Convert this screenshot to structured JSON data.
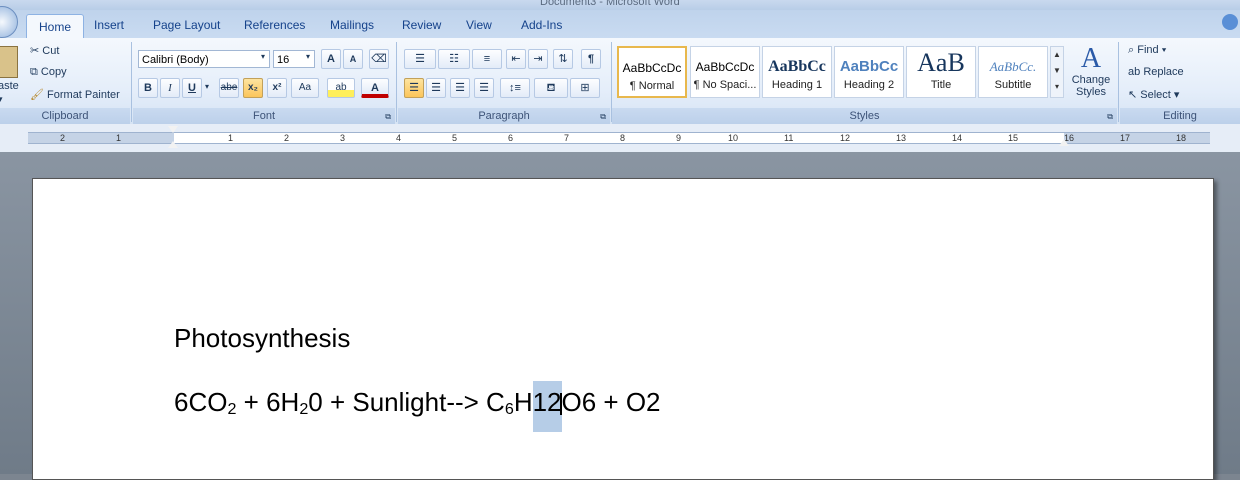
{
  "window": {
    "title": "Document3 - Microsoft Word"
  },
  "tabs": [
    "Home",
    "Insert",
    "Page Layout",
    "References",
    "Mailings",
    "Review",
    "View",
    "Add-Ins"
  ],
  "clipboard": {
    "paste": "aste",
    "cut": "Cut",
    "copy": "Copy",
    "format_painter": "Format Painter",
    "label": "Clipboard"
  },
  "font": {
    "name": "Calibri (Body)",
    "size": "16",
    "grow": "A",
    "shrink": "A",
    "bold": "B",
    "italic": "I",
    "underline": "U",
    "strike": "abe",
    "subscript": "x₂",
    "superscript": "x²",
    "change_case": "Aa",
    "highlight": "ab",
    "color": "A",
    "label": "Font"
  },
  "paragraph": {
    "label": "Paragraph",
    "pilcrow": "¶"
  },
  "styles": {
    "label": "Styles",
    "items": [
      {
        "preview": "AaBbCcDc",
        "name": "¶ Normal"
      },
      {
        "preview": "AaBbCcDc",
        "name": "¶ No Spaci..."
      },
      {
        "preview": "AaBbCc",
        "name": "Heading 1"
      },
      {
        "preview": "AaBbCc",
        "name": "Heading 2"
      },
      {
        "preview": "AaB",
        "name": "Title"
      },
      {
        "preview": "AaBbCc.",
        "name": "Subtitle"
      }
    ],
    "change_styles": "Change Styles"
  },
  "editing": {
    "find": "Find",
    "replace": "Replace",
    "select": "Select",
    "label": "Editing"
  },
  "ruler": {
    "numbers": [
      "2",
      "1",
      "1",
      "2",
      "3",
      "4",
      "5",
      "6",
      "7",
      "8",
      "9",
      "10",
      "11",
      "12",
      "13",
      "14",
      "15",
      "16",
      "17",
      "18"
    ]
  },
  "document": {
    "heading": "Photosynthesis",
    "equation": {
      "p1": "6CO",
      "s1": "2",
      "p2": " + 6H",
      "s2": "2",
      "p3": "0 + Sunlight--> C",
      "s3": "6",
      "p4": "H",
      "sel": "12",
      "p5": "O6 + O2"
    }
  }
}
